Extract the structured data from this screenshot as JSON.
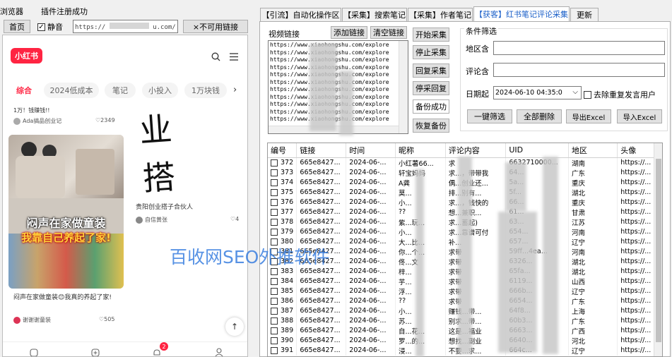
{
  "topbar": {
    "browser_label": "浏览器",
    "plugin_label": "插件注册成功"
  },
  "nav": {
    "home_button": "首页",
    "mute_label": "静音",
    "mute_checked": true,
    "url_value": "https://",
    "url_tail": "u.com/",
    "unavailable_button": "×不可用链接"
  },
  "phone": {
    "logo": "小红书",
    "tabs": [
      "综合",
      "2024低成本",
      "笔记",
      "小投入",
      "1万块钱"
    ],
    "top_left_text": "1万！钱赚钱!!",
    "top_left_author": "Ada搞品创业记",
    "top_left_likes": "2349",
    "card1_overlay_line1": "闷声在家做童装",
    "card1_overlay_line2": "我靠自己养起了家!",
    "card1_title": "闷声在家做童装😊我真的养起了家!",
    "card1_author": "谢谢谢童装",
    "card1_likes": "505",
    "card2_handwriting": "业 搭 子",
    "card2_title": "贵阳创业搭子合伙人",
    "card2_author": "自信黄张",
    "card2_likes": "4",
    "notify_badge": "2"
  },
  "tabs": [
    {
      "label": "【引流】自动化操作区",
      "active": false
    },
    {
      "label": "【采集】搜索笔记",
      "active": false
    },
    {
      "label": "【采集】作者笔记",
      "active": false
    },
    {
      "label": "【获客】红书笔记评论采集",
      "active": true
    },
    {
      "label": "更新",
      "active": false
    }
  ],
  "video_links": {
    "label": "视频链接",
    "add_button": "添加链接",
    "clear_button": "清空链接",
    "lines": [
      "https://www.xiaohongshu.com/explore",
      "https://www.xiaohongshu.com/explore",
      "https://www.xiaohongshu.com/explore",
      "https://www.xiaohongshu.com/explore",
      "https://www.xiaohongshu.com/explore",
      "https://www.xiaohongshu.com/explore",
      "https://www.xiaohongshu.com/explore",
      "https://www.xiaohongshu.com/explore",
      "https://www.xiaohongshu.com/explore",
      "https://www.xiaohongshu.com/explore",
      "https://www.xiaohongshu.com/explore"
    ]
  },
  "actions": {
    "start": "开始采集",
    "stop": "停止采集",
    "resume": "回复采集",
    "pause_reply": "停采回复",
    "backup": "备份成功",
    "restore": "恢复备份"
  },
  "filter": {
    "title": "条件筛选",
    "region_label": "地区含",
    "region_value": "",
    "comment_label": "评论含",
    "comment_value": "",
    "date_label": "日期起",
    "date_value": "2024-06-10 04:35:0",
    "dedupe_label": "去除重复发言用户",
    "btn_filter": "一键筛选",
    "btn_delete": "全部删除",
    "btn_export": "导出Excel",
    "btn_import": "导入Excel"
  },
  "table": {
    "columns": [
      "编号",
      "链接",
      "时间",
      "昵称",
      "评论内容",
      "UID",
      "地区",
      "头像"
    ],
    "rows": [
      [
        "372",
        "665e8427...",
        "2024-06-...",
        "小红薯66...",
        "求",
        "6632710000...",
        "湖南",
        "https://..."
      ],
      [
        "373",
        "665e8427...",
        "2024-06-...",
        "轩宝妈妈",
        "求...，带带我",
        "64...",
        "广东",
        "https://..."
      ],
      [
        "374",
        "665e8427...",
        "2024-06-...",
        "A龚",
        "偶...创业还...",
        "5a...",
        "重庆",
        "https://..."
      ],
      [
        "375",
        "665e8427...",
        "2024-06-...",
        "莫...",
        "排...别有...",
        "5f...",
        "湖北",
        "https://..."
      ],
      [
        "376",
        "665e8427...",
        "2024-06-...",
        "小...",
        "求...，钱快的",
        "66...",
        "重庆",
        "https://..."
      ],
      [
        "377",
        "665e8427...",
        "2024-06-...",
        "??",
        "想...兼职...",
        "61...",
        "甘肃",
        "https://..."
      ],
      [
        "378",
        "665e8427...",
        "2024-06-...",
        "紫...玩...",
        "求...蓄起)",
        "63...",
        "江苏",
        "https://..."
      ],
      [
        "379",
        "665e8427...",
        "2024-06-...",
        "小...",
        "求...靠谱可付",
        "654...",
        "河南",
        "https://..."
      ],
      [
        "380",
        "665e8427...",
        "2024-06-...",
        "大...比...",
        "补...",
        "657...",
        "辽宁",
        "https://..."
      ],
      [
        "381",
        "665e8427...",
        "2024-06-...",
        "你...个...",
        "求带",
        "59ff...4ea...",
        "河南",
        "https://..."
      ],
      [
        "382",
        "665e8427...",
        "2024-06-...",
        "佟...文",
        "求带",
        "6326...",
        "湖北",
        "https://..."
      ],
      [
        "383",
        "665e8427...",
        "2024-06-...",
        "梓...",
        "求带",
        "65fa...",
        "湖北",
        "https://..."
      ],
      [
        "384",
        "665e8427...",
        "2024-06-...",
        "芋...",
        "求带",
        "6119...",
        "山西",
        "https://..."
      ],
      [
        "385",
        "665e8427...",
        "2024-06-...",
        "浮...",
        "求带",
        "666b...",
        "辽宁",
        "https://..."
      ],
      [
        "386",
        "665e8427...",
        "2024-06-...",
        "??",
        "求带",
        "6654...",
        "广东",
        "https://..."
      ],
      [
        "387",
        "665e8427...",
        "2024-06-...",
        "小...",
        "赚钱...带...",
        "64f8...",
        "上海",
        "https://..."
      ],
      [
        "388",
        "665e8427...",
        "2024-06-...",
        "苏...",
        "别求...带...",
        "60b3...",
        "广东",
        "https://..."
      ],
      [
        "389",
        "665e8427...",
        "2024-06-...",
        "自...花...",
        "这是...福业",
        "6663...",
        "广西",
        "https://..."
      ],
      [
        "390",
        "665e8427...",
        "2024-06-...",
        "罗...的...",
        "想找...副业",
        "6640...",
        "河北",
        "https://..."
      ],
      [
        "391",
        "665e8427...",
        "2024-06-...",
        "浸...",
        "不要...求...",
        "664c...",
        "辽宁",
        "https://..."
      ]
    ]
  },
  "watermark": "百收网SEO外推软件",
  "colors": {
    "accent": "#ff2442",
    "tab_active": "#1a5fc8",
    "watermark": "#3a7fe0"
  }
}
